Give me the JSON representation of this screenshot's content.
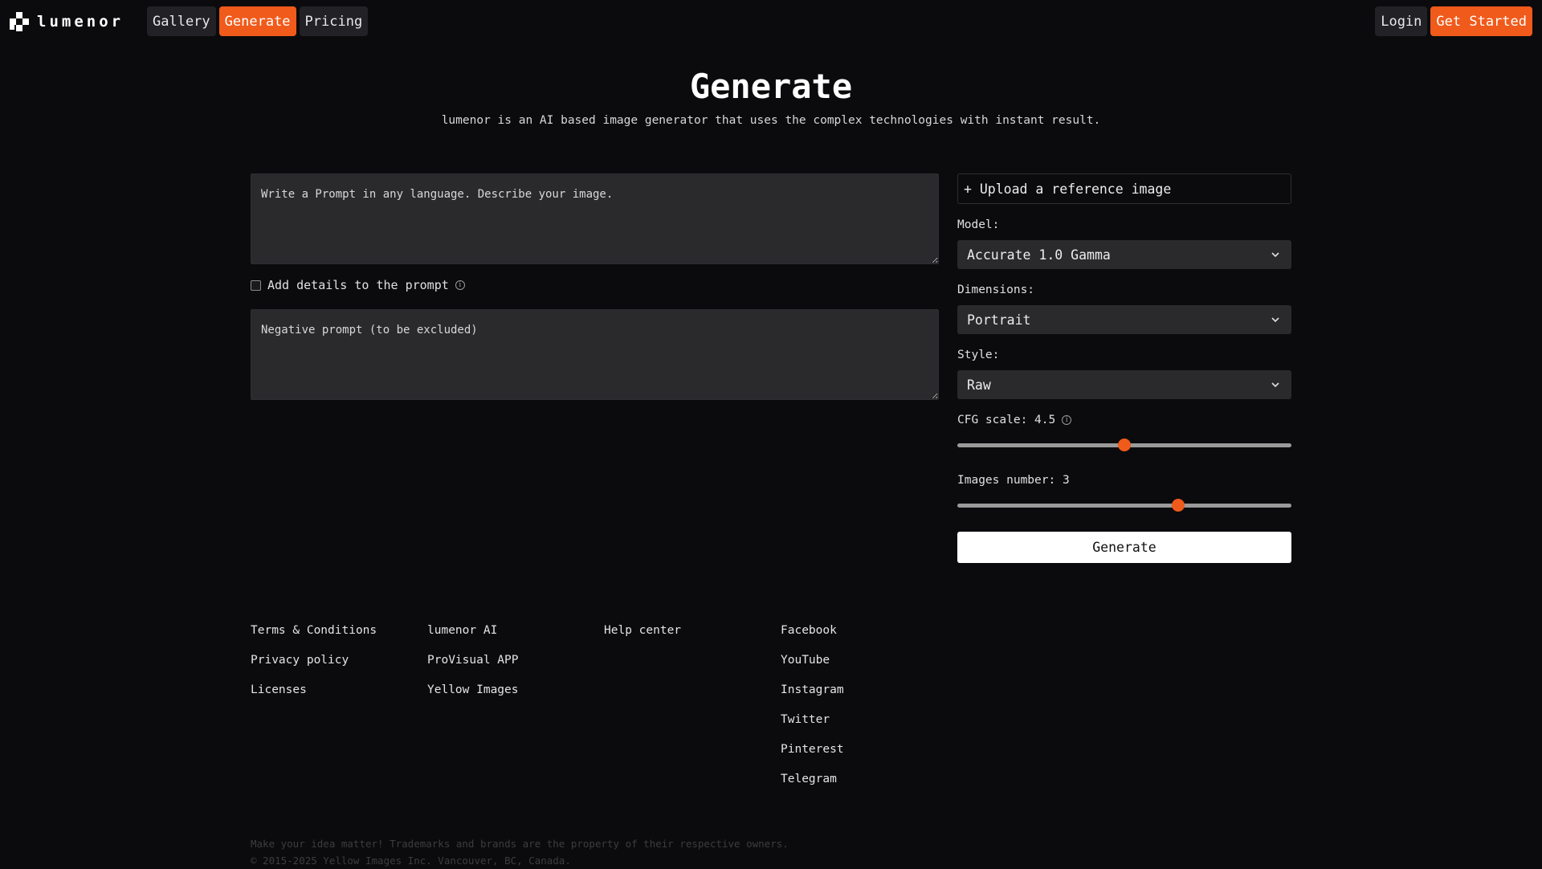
{
  "brand": {
    "name": "lumenor"
  },
  "nav": {
    "items": [
      {
        "label": "Gallery",
        "active": false
      },
      {
        "label": "Generate",
        "active": true
      },
      {
        "label": "Pricing",
        "active": false
      }
    ]
  },
  "auth": {
    "login": "Login",
    "get_started": "Get Started"
  },
  "hero": {
    "title": "Generate",
    "subtitle": "lumenor is an AI based image generator that uses the complex technologies with instant result."
  },
  "prompt": {
    "placeholder": "Write a Prompt in any language. Describe your image.",
    "add_details_label": "Add details to the prompt",
    "add_details_checked": false,
    "negative_placeholder": "Negative prompt (to be excluded)"
  },
  "settings": {
    "upload_label": "+ Upload a reference image",
    "model_label": "Model:",
    "model_value": "Accurate 1.0 Gamma",
    "dimensions_label": "Dimensions:",
    "dimensions_value": "Portrait",
    "style_label": "Style:",
    "style_value": "Raw",
    "cfg_label": "CFG scale: 4.5",
    "cfg_value": 4.5,
    "cfg_fraction": 0.5,
    "images_label": "Images number: 3",
    "images_value": 3,
    "images_fraction": 0.66,
    "generate_button": "Generate"
  },
  "footer": {
    "col1": [
      "Terms & Conditions",
      "Privacy policy",
      "Licenses"
    ],
    "col2": [
      "lumenor AI",
      "ProVisual APP",
      "Yellow Images"
    ],
    "col3": [
      "Help center"
    ],
    "col4": [
      "Facebook",
      "YouTube",
      "Instagram",
      "Twitter",
      "Pinterest",
      "Telegram"
    ],
    "legal_line1": "Make your idea matter! Trademarks and brands are the property of their respective owners.",
    "legal_line2": "© 2015-2025 Yellow Images Inc. Vancouver, BC, Canada."
  },
  "colors": {
    "accent": "#f05a1a",
    "background": "#0b0b0d",
    "surface": "#2a2a2d"
  }
}
